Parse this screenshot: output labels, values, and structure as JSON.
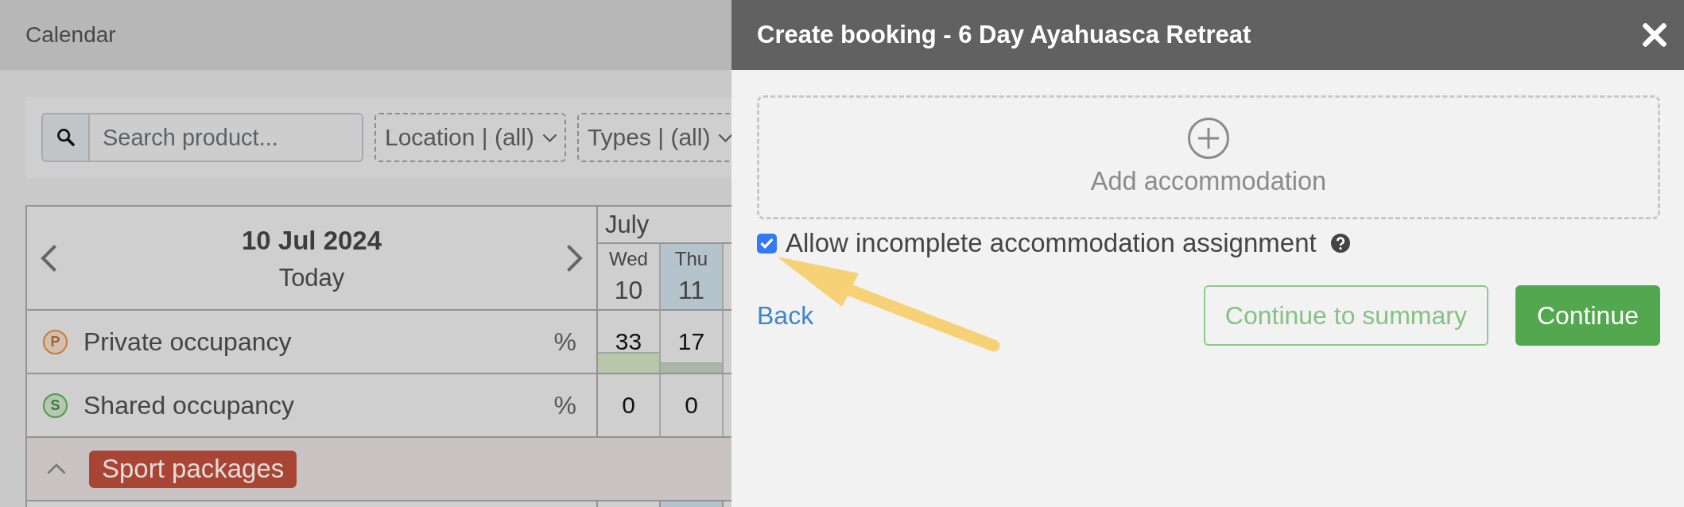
{
  "page": {
    "title": "Calendar"
  },
  "filters": {
    "search": {
      "placeholder": "Search product..."
    },
    "dropdowns": [
      {
        "label": "Location | (all)"
      },
      {
        "label": "Types | (all)"
      }
    ]
  },
  "calendar": {
    "date": "10 Jul 2024",
    "today": "Today",
    "month": "July",
    "days": [
      {
        "weekday": "Wed",
        "day": "10",
        "highlighted": false
      },
      {
        "weekday": "Thu",
        "day": "11",
        "highlighted": true
      }
    ],
    "rows": [
      {
        "kind": "occupancy",
        "badge": "P",
        "color": "#c87a3c",
        "label": "Private occupancy",
        "unit": "%",
        "cells": [
          {
            "value": "33",
            "level": 0.33
          },
          {
            "value": "17",
            "level": 0.17
          }
        ]
      },
      {
        "kind": "occupancy",
        "badge": "S",
        "color": "#4f9a48",
        "label": "Shared occupancy",
        "unit": "%",
        "cells": [
          {
            "value": "0"
          },
          {
            "value": "0"
          }
        ]
      },
      {
        "kind": "group",
        "label": "Sport packages",
        "expanded": true,
        "color": "#a84535"
      }
    ]
  },
  "dialog": {
    "title": "Create booking - 6 Day Ayahuasca Retreat",
    "add_accommodation": "Add accommodation",
    "checkbox": {
      "label": "Allow incomplete accommodation assignment",
      "checked": true
    },
    "back_link": "Back",
    "buttons": [
      {
        "label": "Continue to summary",
        "kind": "outline"
      },
      {
        "label": "Continue",
        "kind": "primary"
      }
    ]
  }
}
